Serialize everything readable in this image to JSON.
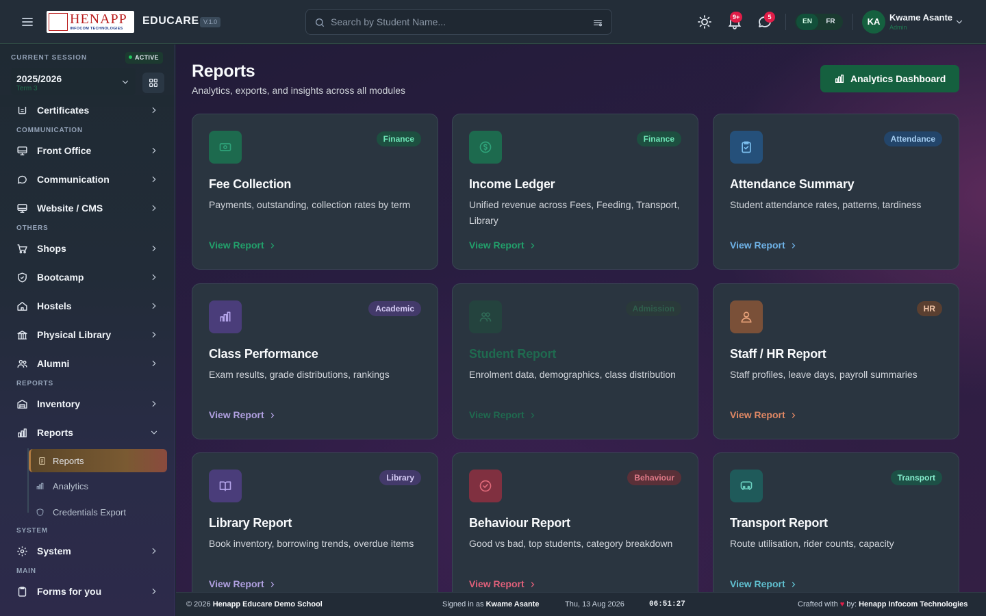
{
  "header": {
    "menu_icon": "hamburger-icon",
    "logo": {
      "main": "HENAPP",
      "sub": "INFOCOM TECHNOLOGIES"
    },
    "brand": "EDUCARE",
    "version": "V.1.0",
    "search_placeholder": "Search by Student Name...",
    "notification_count": "9+",
    "message_count": "5",
    "languages": [
      "EN",
      "FR"
    ],
    "user": {
      "initials": "KA",
      "name": "Kwame Asante",
      "role": "Admin"
    }
  },
  "sidebar": {
    "session_label": "CURRENT SESSION",
    "session_status": "ACTIVE",
    "session_year": "2025/2026",
    "session_term": "Term 3",
    "top_item": "Certificates",
    "sections": {
      "communication": "COMMUNICATION",
      "others": "OTHERS",
      "reports": "REPORTS",
      "system": "SYSTEM",
      "main": "MAIN"
    },
    "items": {
      "front_office": "Front Office",
      "communication": "Communication",
      "website_cms": "Website / CMS",
      "shops": "Shops",
      "bootcamp": "Bootcamp",
      "hostels": "Hostels",
      "physical_library": "Physical Library",
      "alumni": "Alumni",
      "inventory": "Inventory",
      "reports": "Reports",
      "system": "System",
      "forms": "Forms for you"
    },
    "sub_items": {
      "reports": "Reports",
      "analytics": "Analytics",
      "credentials": "Credentials Export"
    }
  },
  "page": {
    "title": "Reports",
    "subtitle": "Analytics, exports, and insights across all modules",
    "dashboard_button": "Analytics Dashboard",
    "link_label": "View Report",
    "cards": [
      {
        "tag": "Finance",
        "title": "Fee Collection",
        "desc": "Payments, outstanding, collection rates by term"
      },
      {
        "tag": "Finance",
        "title": "Income Ledger",
        "desc": "Unified revenue across Fees, Feeding, Transport, Library"
      },
      {
        "tag": "Attendance",
        "title": "Attendance Summary",
        "desc": "Student attendance rates, patterns, tardiness"
      },
      {
        "tag": "Academic",
        "title": "Class Performance",
        "desc": "Exam results, grade distributions, rankings"
      },
      {
        "tag": "Admission",
        "title": "Student Report",
        "desc": "Enrolment data, demographics, class distribution"
      },
      {
        "tag": "HR",
        "title": "Staff / HR Report",
        "desc": "Staff profiles, leave days, payroll summaries"
      },
      {
        "tag": "Library",
        "title": "Library Report",
        "desc": "Book inventory, borrowing trends, overdue items"
      },
      {
        "tag": "Behaviour",
        "title": "Behaviour Report",
        "desc": "Good vs bad, top students, category breakdown"
      },
      {
        "tag": "Transport",
        "title": "Transport Report",
        "desc": "Route utilisation, rider counts, capacity"
      }
    ]
  },
  "footer": {
    "copyright_prefix": "© 2026",
    "school": "Henapp Educare Demo School",
    "signed_prefix": "Signed in as",
    "signed_user": "Kwame Asante",
    "date": "Thu, 13 Aug 2026",
    "time": "06:51:27",
    "crafted_prefix": "Crafted with",
    "crafted_by": "by:",
    "company": "Henapp Infocom Technologies"
  }
}
